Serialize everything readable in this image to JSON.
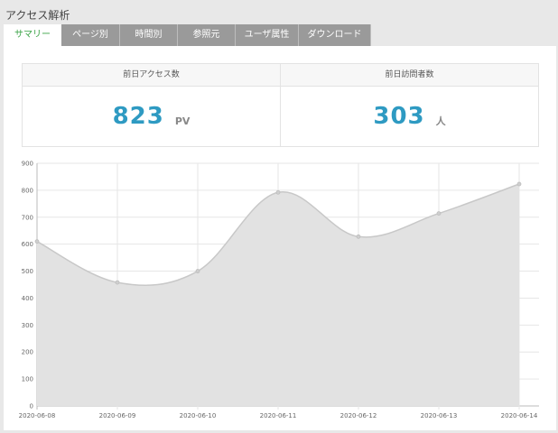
{
  "page": {
    "title": "アクセス解析"
  },
  "tabs": [
    {
      "label": "サマリー",
      "active": true
    },
    {
      "label": "ページ別",
      "active": false
    },
    {
      "label": "時間別",
      "active": false
    },
    {
      "label": "参照元",
      "active": false
    },
    {
      "label": "ユーザ属性",
      "active": false
    },
    {
      "label": "ダウンロード",
      "active": false
    }
  ],
  "stats": {
    "pv": {
      "label": "前日アクセス数",
      "value": "823",
      "unit": "PV"
    },
    "users": {
      "label": "前日訪問者数",
      "value": "303",
      "unit": "人"
    }
  },
  "colors": {
    "accent": "#2e9ac2",
    "active_tab": "#3aa346",
    "tab_bg": "#9a9a9a",
    "fill": "#e2e2e2",
    "line": "#c8c8c8"
  },
  "chart_data": {
    "type": "area",
    "categories": [
      "2020-06-08",
      "2020-06-09",
      "2020-06-10",
      "2020-06-11",
      "2020-06-12",
      "2020-06-13",
      "2020-06-14"
    ],
    "values": [
      610,
      458,
      500,
      792,
      628,
      714,
      823
    ],
    "ylim": [
      0,
      900
    ],
    "yticks": [
      0,
      100,
      200,
      300,
      400,
      500,
      600,
      700,
      800,
      900
    ],
    "grid": true,
    "legend": "none"
  }
}
